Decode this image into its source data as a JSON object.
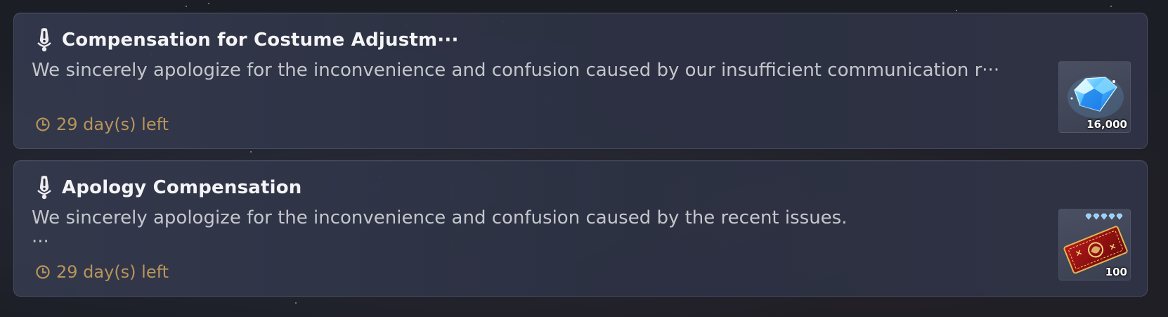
{
  "mails": [
    {
      "title": "Compensation for Costume Adjustm···",
      "body_line1": "We sincerely apologize for the inconvenience and confusion caused by our insufficient communication r···",
      "body_line2": "",
      "expire": "29 day(s) left",
      "reward": {
        "icon": "blue-crystal-icon",
        "count": "16,000"
      }
    },
    {
      "title": "Apology Compensation",
      "body_line1": "We sincerely apologize for the inconvenience and confusion caused by the recent issues.",
      "body_line2": "···",
      "expire": "29 day(s) left",
      "reward": {
        "icon": "red-ticket-icon",
        "count": "100"
      }
    }
  ],
  "colors": {
    "expire": "#b8955a",
    "title": "#f4f4f6",
    "body": "#c4c6cc"
  }
}
